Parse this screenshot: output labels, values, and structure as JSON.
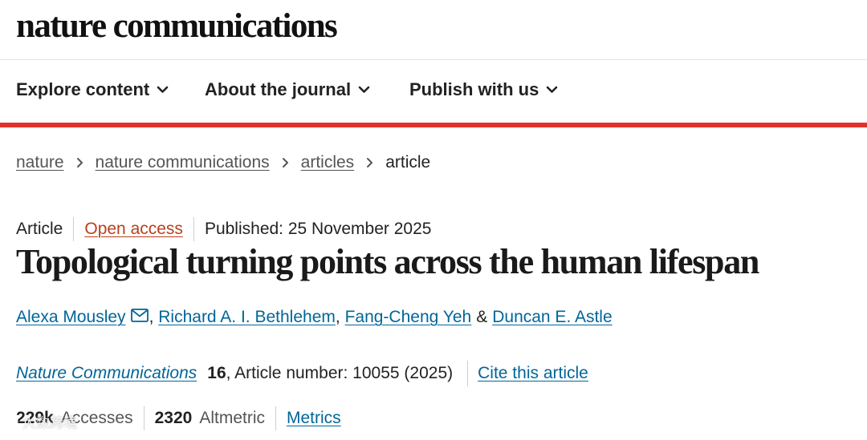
{
  "header": {
    "logo_text": "nature communications"
  },
  "nav": {
    "items": [
      {
        "label": "Explore content",
        "icon": "chevron-down-icon"
      },
      {
        "label": "About the journal",
        "icon": "chevron-down-icon"
      },
      {
        "label": "Publish with us",
        "icon": "chevron-down-icon"
      }
    ]
  },
  "breadcrumb": {
    "items": [
      "nature",
      "nature communications",
      "articles"
    ],
    "current": "article",
    "separator_icon": "chevron-right-icon"
  },
  "article": {
    "type": "Article",
    "open_access": "Open access",
    "published": "Published: 25 November 2025",
    "title": "Topological turning points across the human lifespan",
    "authors": [
      "Alexa Mousley",
      "Richard A. I. Bethlehem",
      "Fang-Cheng Yeh",
      "Duncan E. Astle"
    ],
    "author_separator": ",",
    "author_last_joiner": "&",
    "corresponding_icon": "mail-icon",
    "journal": "Nature Communications",
    "volume": "16",
    "article_number": ", Article number: 10055 (2025)",
    "cite_label": "Cite this article"
  },
  "metrics": {
    "accesses_value": "229k",
    "accesses_label": "Accesses",
    "altmetric_value": "2320",
    "altmetric_label": "Altmetric",
    "metrics_link": "Metrics"
  },
  "watermark": {
    "text": "大数跨境",
    "icon": "watermark-logo-icon"
  },
  "colors": {
    "accent_red": "#e0312b",
    "link_blue": "#006699",
    "open_access_orange": "#b9401d",
    "text_dark": "#222222",
    "text_gray": "#555555"
  }
}
